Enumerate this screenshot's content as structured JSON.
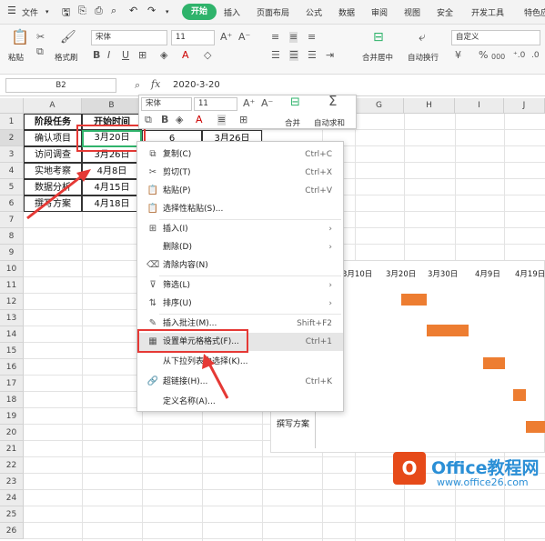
{
  "menubar": {
    "file": "文件",
    "tabs": [
      "开始",
      "插入",
      "页面布局",
      "公式",
      "数据",
      "审阅",
      "视图",
      "安全",
      "开发工具",
      "特色应"
    ]
  },
  "ribbon": {
    "paste": "粘贴",
    "format_painter": "格式刷",
    "font_name": "宋体",
    "font_size": "11",
    "bold": "B",
    "italic": "I",
    "underline": "U",
    "merge_center": "合并居中",
    "auto_wrap": "自动换行",
    "number_format": "自定义",
    "percent": "%",
    "thousands": "000"
  },
  "formula_bar": {
    "name_box": "B2",
    "fx": "fx",
    "formula": "2020-3-20"
  },
  "columns": [
    "A",
    "B",
    "C",
    "D",
    "E",
    "F",
    "G",
    "H",
    "I",
    "J"
  ],
  "rows": [
    "1",
    "2",
    "3",
    "4",
    "5",
    "6",
    "7",
    "8",
    "9",
    "10",
    "11",
    "12",
    "13",
    "14",
    "15",
    "16",
    "17",
    "18",
    "19",
    "20",
    "21",
    "22",
    "23",
    "24",
    "25",
    "26"
  ],
  "table": {
    "headers": [
      "阶段任务",
      "开始时间"
    ],
    "tasks": [
      "确认项目",
      "访问调查",
      "实地考察",
      "数据分析",
      "撰写方案"
    ],
    "start_dates": [
      "3月20日",
      "3月26日",
      "4月8日",
      "4月15日",
      "4月18日"
    ],
    "c2": "6",
    "d2": "3月26日"
  },
  "mini_toolbar": {
    "font_name": "宋体",
    "font_size": "11",
    "merge": "合并",
    "autosum": "自动求和"
  },
  "context_menu": {
    "items": [
      {
        "label": "复制(C)",
        "shortcut": "Ctrl+C",
        "icon": "copy-icon"
      },
      {
        "label": "剪切(T)",
        "shortcut": "Ctrl+X",
        "icon": "cut-icon"
      },
      {
        "label": "粘贴(P)",
        "shortcut": "Ctrl+V",
        "icon": "paste-icon"
      },
      {
        "label": "选择性粘贴(S)...",
        "shortcut": "",
        "icon": "paste-special-icon"
      },
      {
        "label": "插入(I)",
        "shortcut": "",
        "icon": "insert-icon"
      },
      {
        "label": "删除(D)",
        "shortcut": "",
        "icon": ""
      },
      {
        "label": "清除内容(N)",
        "shortcut": "",
        "icon": "clear-icon"
      },
      {
        "label": "筛选(L)",
        "shortcut": "",
        "icon": "filter-icon"
      },
      {
        "label": "排序(U)",
        "shortcut": "",
        "icon": "sort-icon"
      },
      {
        "label": "插入批注(M)...",
        "shortcut": "Shift+F2",
        "icon": "comment-icon"
      },
      {
        "label": "设置单元格格式(F)...",
        "shortcut": "Ctrl+1",
        "icon": "format-cells-icon"
      },
      {
        "label": "从下拉列表中选择(K)...",
        "shortcut": "",
        "icon": ""
      },
      {
        "label": "超链接(H)...",
        "shortcut": "Ctrl+K",
        "icon": "link-icon"
      },
      {
        "label": "定义名称(A)...",
        "shortcut": "",
        "icon": ""
      }
    ]
  },
  "chart": {
    "date_labels": [
      "3月10日",
      "3月20日",
      "3月30日",
      "4月9日",
      "4月19日"
    ],
    "category_label": "撰写方案"
  },
  "watermark": {
    "brand": "Office教程网",
    "url": "www.office26.com"
  },
  "colors": {
    "accent_green": "#2fb36b",
    "highlight_red": "#e53935",
    "bar_orange": "#ed7d31"
  }
}
